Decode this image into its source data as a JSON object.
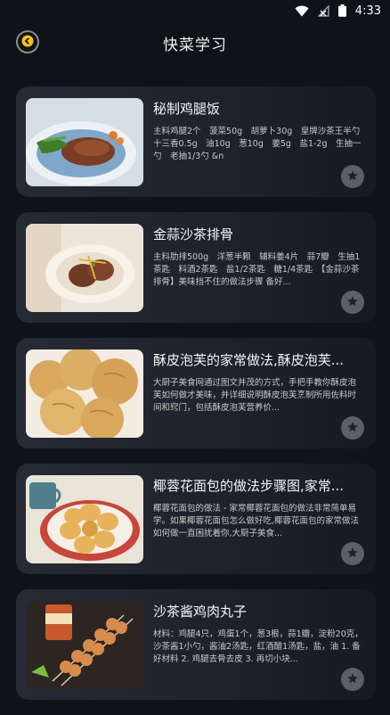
{
  "status": {
    "time": "4:33"
  },
  "header": {
    "title": "快菜学习"
  },
  "recipes": [
    {
      "title": "秘制鸡腿饭",
      "desc": "主料鸡腿2个　菠菜50g　胡萝卜30g　皇牌沙茶王半勺　十三香0.5g　油10g　葱10g　姜5g　盐1-2g　生抽一勺　老抽1/3勺 &n"
    },
    {
      "title": "金蒜沙茶排骨",
      "desc": "主料肋排500g　洋葱半颗　辅料姜4片　蒜7瓣　生抽1茶匙　料酒2茶匙　盐1/2茶匙　糖1/4茶匙　【金蒜沙茶排骨】美味挡不住的做法步骤 备好..."
    },
    {
      "title": "酥皮泡芙的家常做法,酥皮泡芙...",
      "desc": "大厨子美食网通过图文并茂的方式，手把手教你酥皮泡芙如何做才美味，并详细说明酥皮泡芙烹制所用佐料时间和窍门，包括酥皮泡芙营养价..."
    },
    {
      "title": "椰蓉花面包的做法步骤图,家常...",
      "desc": "椰蓉花面包的做法 - 家常椰蓉花面包的做法非常简单易学。如果椰蓉花面包怎么做好吃,椰蓉花面包的家常做法如何做一直困扰着你,大厨子美食..."
    },
    {
      "title": "沙茶酱鸡肉丸子",
      "desc": "材料：鸡腿4只，鸡蛋1个，葱3根，蒜1瓣，淀粉20克，沙茶酱1小勺，酱油2汤匙，红酒醋1汤匙，盐，油 1. 备好材料 2. 鸡腿去骨去皮 3. 再切小块..."
    }
  ]
}
